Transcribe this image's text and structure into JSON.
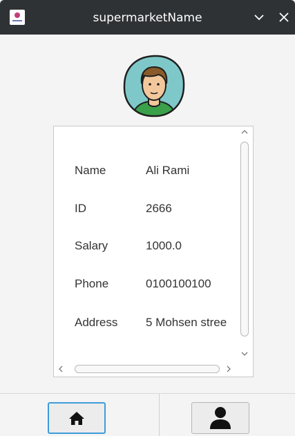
{
  "window": {
    "title": "supermarketName"
  },
  "profile": {
    "fields": [
      {
        "label": "Name",
        "value": "Ali Rami"
      },
      {
        "label": "ID",
        "value": "2666"
      },
      {
        "label": "Salary",
        "value": "1000.0"
      },
      {
        "label": "Phone",
        "value": "0100100100"
      },
      {
        "label": "Address",
        "value": "5 Mohsen stree"
      }
    ]
  },
  "icons": {
    "app": "app-logo-icon",
    "minimize": "chevron-down-icon",
    "close": "close-icon",
    "avatar": "user-avatar-icon",
    "home": "home-icon",
    "profile": "person-icon"
  },
  "colors": {
    "titlebar": "#2f3235",
    "accent_focus": "#3d9bd8",
    "avatar_bg": "#7fc8c9",
    "shirt": "#3aa04a"
  }
}
